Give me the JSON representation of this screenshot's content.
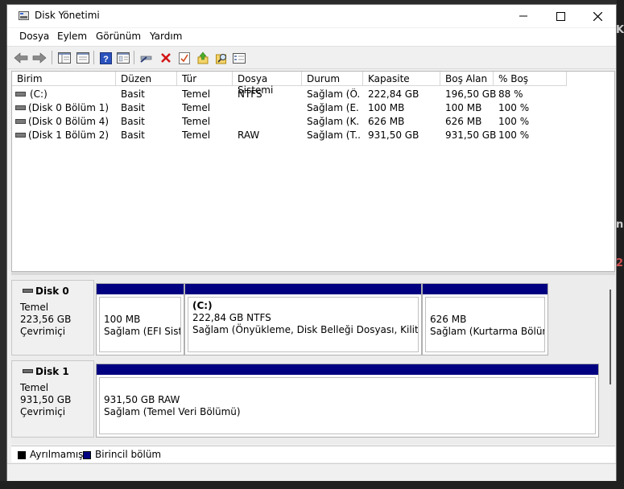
{
  "window": {
    "title": "Disk Yönetimi"
  },
  "menu": [
    "Dosya",
    "Eylem",
    "Görünüm",
    "Yardım"
  ],
  "background_fragments": [
    "Ku",
    "n",
    "2"
  ],
  "toolbar_icons": [
    "back-arrow-icon",
    "forward-arrow-icon",
    "console-tree-icon",
    "help-icon",
    "properties-icon",
    "connect-icon",
    "delete-icon",
    "check-icon",
    "import-icon",
    "search-icon",
    "view-icon"
  ],
  "volume_list": {
    "columns": [
      "Birim",
      "Düzen",
      "Tür",
      "Dosya Sistemi",
      "Durum",
      "Kapasite",
      "Boş Alan",
      "% Boş"
    ],
    "rows": [
      [
        "(C:)",
        "Basit",
        "Temel",
        "NTFS",
        "Sağlam (Ö...",
        "222,84 GB",
        "196,50 GB",
        "88 %"
      ],
      [
        "(Disk 0 Bölüm 1)",
        "Basit",
        "Temel",
        "",
        "Sağlam (E...",
        "100 MB",
        "100 MB",
        "100 %"
      ],
      [
        "(Disk 0 Bölüm 4)",
        "Basit",
        "Temel",
        "",
        "Sağlam (K...",
        "626 MB",
        "626 MB",
        "100 %"
      ],
      [
        "(Disk 1 Bölüm 2)",
        "Basit",
        "Temel",
        "RAW",
        "Sağlam (T...",
        "931,50 GB",
        "931,50 GB",
        "100 %"
      ]
    ]
  },
  "disks": [
    {
      "name": "Disk 0",
      "type": "Temel",
      "size": "223,56 GB",
      "status": "Çevrimiçi",
      "partitions": [
        {
          "title": "",
          "line1": "100 MB",
          "line2": "Sağlam (EFI Sisten"
        },
        {
          "title": "(C:)",
          "line1": "222,84 GB NTFS",
          "line2": "Sağlam (Önyükleme, Disk Belleği Dosyası, Kilitlenme"
        },
        {
          "title": "",
          "line1": "626 MB",
          "line2": "Sağlam (Kurtarma Bölümü"
        }
      ]
    },
    {
      "name": "Disk 1",
      "type": "Temel",
      "size": "931,50 GB",
      "status": "Çevrimiçi",
      "partitions": [
        {
          "title": "",
          "line1": "931,50 GB RAW",
          "line2": "Sağlam (Temel Veri Bölümü)"
        }
      ]
    }
  ],
  "legend": [
    {
      "label": "Ayrılmamış",
      "color": "#000000"
    },
    {
      "label": "Birincil bölüm",
      "color": "#000080"
    }
  ]
}
